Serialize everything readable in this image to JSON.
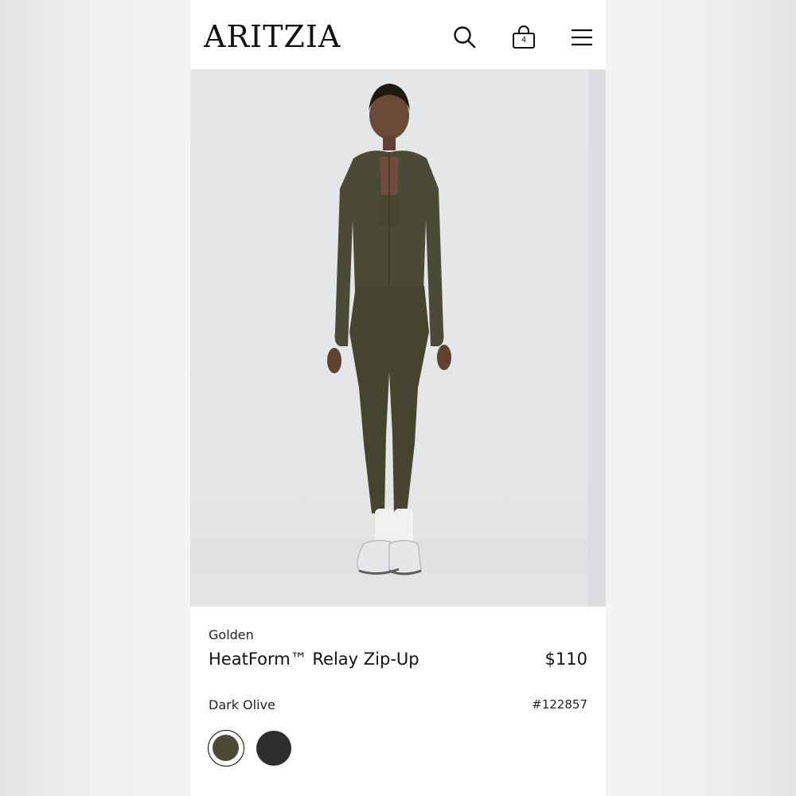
{
  "header": {
    "logo": "ARITZIA",
    "bag_count": "4"
  },
  "icons": {
    "search": "search-icon",
    "bag": "shopping-bag-icon",
    "menu": "hamburger-menu-icon"
  },
  "product": {
    "brand": "Golden",
    "name": "HeatForm™ Relay Zip-Up",
    "price": "$110",
    "color_name": "Dark Olive",
    "sku": "#122857",
    "swatches": [
      {
        "name": "Dark Olive",
        "hex": "#4b4a36",
        "selected": true
      },
      {
        "name": "Black",
        "hex": "#2c2d2f",
        "selected": false
      }
    ]
  },
  "colors": {
    "olive": "#4b4a36",
    "black": "#2c2d2f",
    "hero_bg": "#e7e8ea"
  }
}
